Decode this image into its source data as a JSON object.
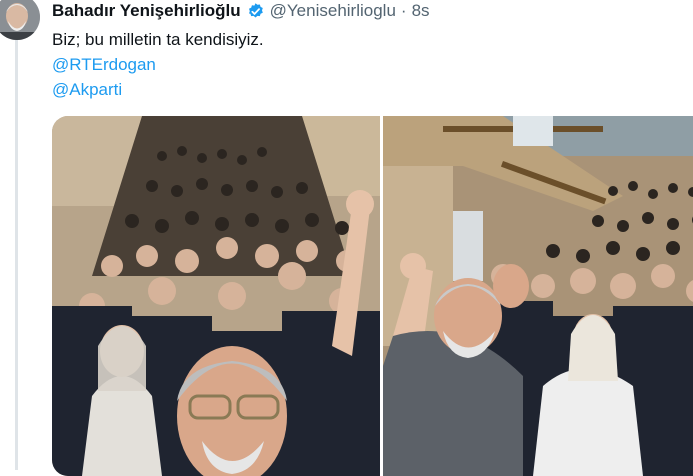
{
  "tweet": {
    "author_name": "Bahadır Yenişehirlioğlu",
    "author_handle": "@Yenisehirlioglu",
    "separator": "·",
    "time": "8s",
    "text": "Biz; bu milletin ta kendisiyiz.",
    "mentions": [
      "@RTErdogan",
      "@Akparti"
    ]
  },
  "icons": {
    "verified": "verified-badge-icon",
    "avatar": "profile-avatar"
  },
  "colors": {
    "link": "#1d9bf0",
    "name": "#0f1419",
    "meta": "#536471",
    "verified": "#1d9bf0"
  },
  "media": {
    "photos": [
      {
        "label": "group selfie in parliament stairwell"
      },
      {
        "label": "group selfie in parliament hall with balcony"
      }
    ]
  }
}
